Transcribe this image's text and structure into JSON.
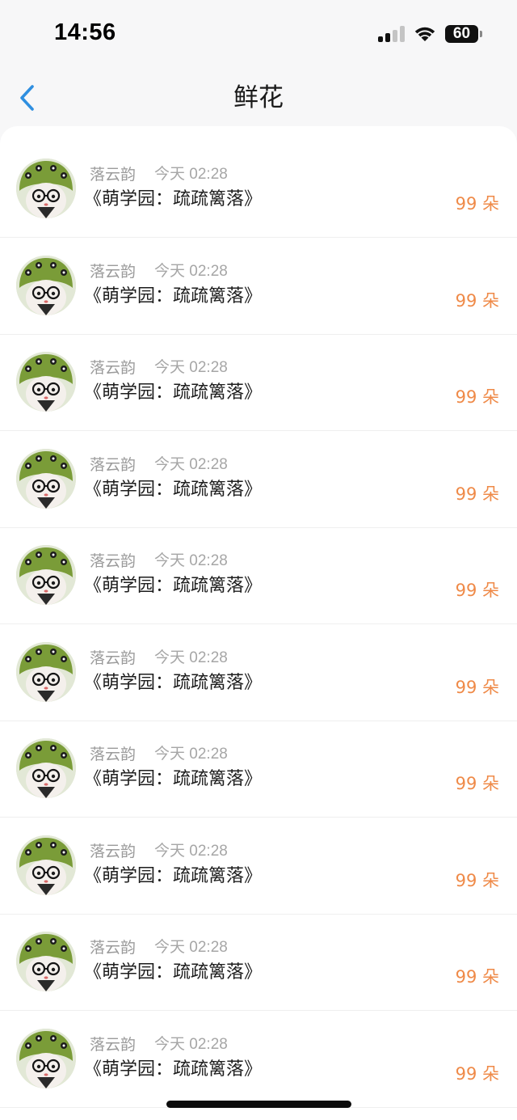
{
  "status_bar": {
    "time": "14:56",
    "battery_level": "60"
  },
  "nav": {
    "title": "鲜花"
  },
  "gifts": [
    {
      "sender": "落云韵",
      "time": "今天 02:28",
      "work": "《萌学园：疏疏篱落》",
      "amount": "99 朵"
    },
    {
      "sender": "落云韵",
      "time": "今天 02:28",
      "work": "《萌学园：疏疏篱落》",
      "amount": "99 朵"
    },
    {
      "sender": "落云韵",
      "time": "今天 02:28",
      "work": "《萌学园：疏疏篱落》",
      "amount": "99 朵"
    },
    {
      "sender": "落云韵",
      "time": "今天 02:28",
      "work": "《萌学园：疏疏篱落》",
      "amount": "99 朵"
    },
    {
      "sender": "落云韵",
      "time": "今天 02:28",
      "work": "《萌学园：疏疏篱落》",
      "amount": "99 朵"
    },
    {
      "sender": "落云韵",
      "time": "今天 02:28",
      "work": "《萌学园：疏疏篱落》",
      "amount": "99 朵"
    },
    {
      "sender": "落云韵",
      "time": "今天 02:28",
      "work": "《萌学园：疏疏篱落》",
      "amount": "99 朵"
    },
    {
      "sender": "落云韵",
      "time": "今天 02:28",
      "work": "《萌学园：疏疏篱落》",
      "amount": "99 朵"
    },
    {
      "sender": "落云韵",
      "time": "今天 02:28",
      "work": "《萌学园：疏疏篱落》",
      "amount": "99 朵"
    },
    {
      "sender": "落云韵",
      "time": "今天 02:28",
      "work": "《萌学园：疏疏篱落》",
      "amount": "99 朵"
    }
  ],
  "colors": {
    "accent_blue": "#2f8fe0",
    "amount_orange": "#ef8a48",
    "meta_gray": "#9b9b9b"
  },
  "icons": {
    "back": "chevron-left-icon",
    "signal": "cellular-signal-icon",
    "wifi": "wifi-icon",
    "battery": "battery-icon"
  }
}
